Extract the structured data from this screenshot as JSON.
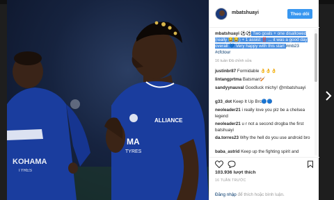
{
  "post": {
    "username": "mbatshuayi",
    "follow_label": "Theo dõi",
    "caption_user": "mbatshuayi",
    "caption_emoji": "⚽⚽",
    "caption_text": " Two goals + one disallowed (really 😂😂) + 1 assist ‼️ ... it was a good day overall 💙 Very happy with this start ",
    "caption_tags": "#mb23 #cfctour",
    "caption_meta": "16 tuần   Đã chỉnh sửa"
  },
  "comments": [
    {
      "user": "justinbr87",
      "text": " Formidable 👌👌👌"
    },
    {
      "user": "lintangprtma",
      "text": " Batsman🏏"
    },
    {
      "user": "sandyynauval",
      "text": " Goodluck michy! @mbatshuayi"
    },
    {
      "user": "g33_dot",
      "text": " Keep It Up Brc🔵🔵"
    },
    {
      "user": "neoleader21",
      "text": " i really love you plz be a chelsea legend"
    },
    {
      "user": "neoleader21",
      "text": " u r not a second drogba the first batshuayi"
    },
    {
      "user": "da.torres23",
      "text": " Why the hell do you use android bro"
    },
    {
      "user": "baba_astrid",
      "text": " Keep up the fighting spirit and"
    }
  ],
  "footer": {
    "likes": "103.936 lượt thích",
    "timestamp": "16 TUẦN TRƯỚC",
    "login_link": "Đăng nhập",
    "login_text": " để thích hoặc bình luận."
  },
  "photo": {
    "shirt_sponsor_left": "YOKOHAMA TYRES",
    "shirt_sponsor_main": "YOKOHAMA TYRES",
    "sleeve_text": "ALLIANCE"
  },
  "colors": {
    "follow_button": "#3897f0",
    "highlight": "#4a90e2",
    "chelsea_blue": "#1a3d9e"
  },
  "icons": [
    "heart-icon",
    "comment-icon",
    "bookmark-icon",
    "next-arrow-icon"
  ]
}
